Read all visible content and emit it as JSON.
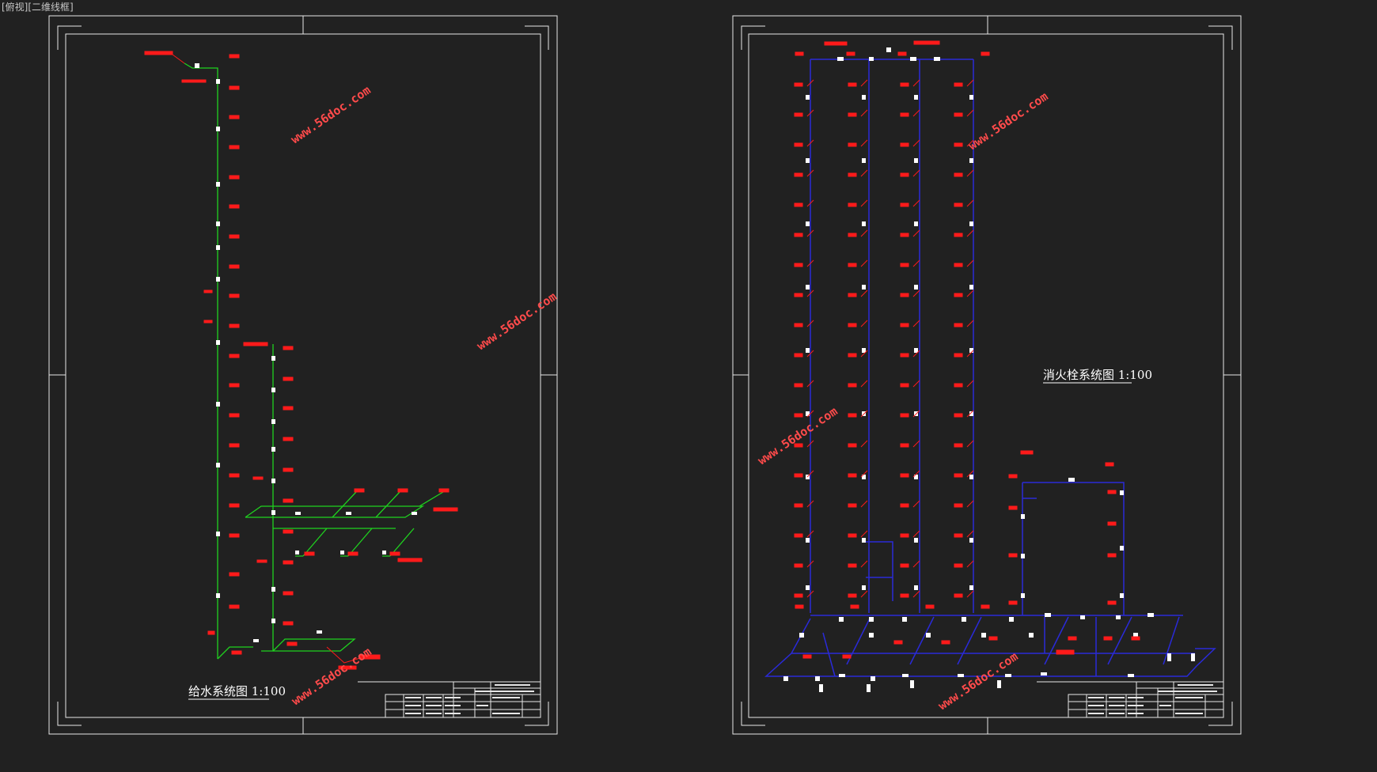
{
  "viewport_label": "[俯视][二维线框]",
  "sheets": [
    {
      "title": "给水系统图 1:100",
      "system": "water-supply"
    },
    {
      "title": "消火栓系统图 1:100",
      "system": "fire-hydrant"
    }
  ],
  "watermark_text": "www.56doc.com",
  "colors": {
    "background": "#212121",
    "frame": "#e6e6e6",
    "water_pipe": "#1fd21f",
    "fire_pipe": "#2a2ad8",
    "label_red": "#ff1a1a",
    "fixture_white": "#ffffff",
    "watermark": "#ff4b4b"
  }
}
